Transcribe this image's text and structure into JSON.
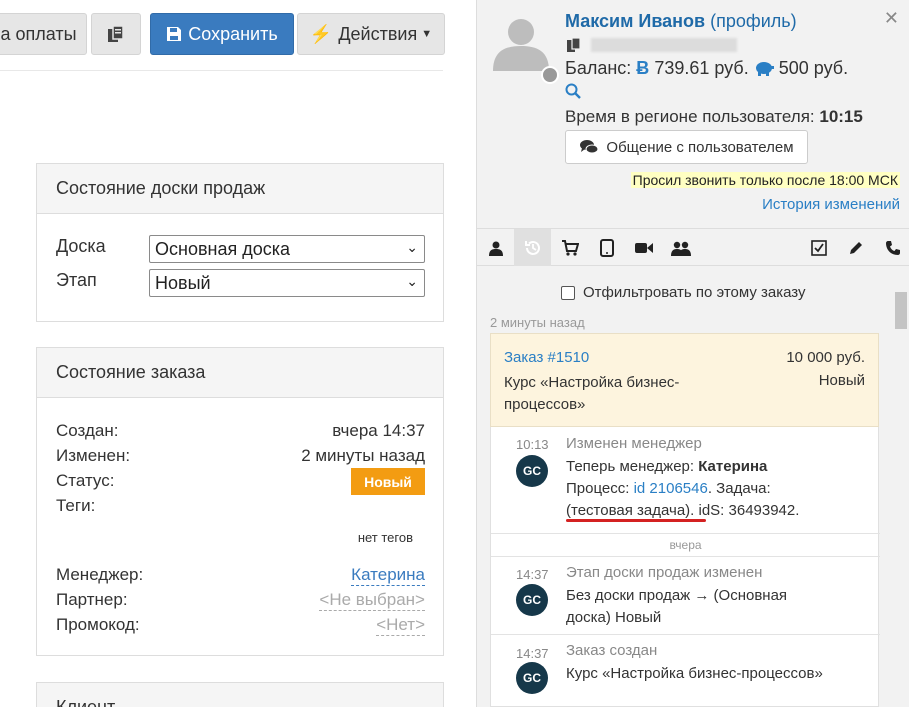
{
  "toolbar": {
    "pay_label": "а оплаты",
    "save_label": "Сохранить",
    "actions_label": "Действия"
  },
  "board_state": {
    "title": "Состояние доски продаж",
    "board_label": "Доска",
    "board_value": "Основная доска",
    "stage_label": "Этап",
    "stage_value": "Новый"
  },
  "order_state": {
    "title": "Состояние заказа",
    "created_label": "Создан:",
    "created_value": "вчера 14:37",
    "changed_label": "Изменен:",
    "changed_value": "2 минуты назад",
    "status_label": "Статус:",
    "status_value": "Новый",
    "status_color": "#f39c12",
    "tags_label": "Теги:",
    "tags_value": "нет тегов",
    "manager_label": "Менеджер:",
    "manager_value": "Катерина",
    "partner_label": "Партнер:",
    "partner_value": "<Не выбран>",
    "promo_label": "Промокод:",
    "promo_value": "<Нет>"
  },
  "client_section": {
    "title": "Клиент"
  },
  "user": {
    "name": "Максим Иванов",
    "profile_link": "(профиль)",
    "balance_label": "Баланс:",
    "balance_value": "739.61 руб.",
    "bonus_value": "500 руб.",
    "region_time_label": "Время в регионе пользователя:",
    "region_time_value": "10:15",
    "chat_button": "Общение с пользователем",
    "note": "Просил звонить только после 18:00 МСК",
    "history_link": "История изменений"
  },
  "tabs": [
    {
      "icon": "user-icon"
    },
    {
      "icon": "history-icon",
      "active": true
    },
    {
      "icon": "cart-icon"
    },
    {
      "icon": "tablet-icon"
    },
    {
      "icon": "video-icon"
    },
    {
      "icon": "group-icon"
    },
    {
      "icon": "checkbox-icon"
    },
    {
      "icon": "pencil-icon"
    },
    {
      "icon": "phone-icon"
    }
  ],
  "feed": {
    "filter_label": "Отфильтровать по этому заказу",
    "filter_checked": false,
    "timestamp": "2 минуты назад",
    "order": {
      "link": "Заказ #1510",
      "sum": "10 000 руб.",
      "name": "Курс «Настройка бизнес-процессов»",
      "status": "Новый"
    },
    "events": [
      {
        "time": "10:13",
        "title": "Изменен менеджер",
        "line1_prefix": "Теперь менеджер: ",
        "line1_bold": "Катерина",
        "proc_label": "Процесс: ",
        "proc_link": "id 2106546",
        "task_label": ". Задача:",
        "task_name": "(тестовая задача)",
        "ids_label": ". idS: 36493942."
      },
      {
        "time": "14:37",
        "title": "Этап доски продаж изменен",
        "body": "Без доски продаж → (Основная доска) Новый"
      },
      {
        "time": "14:37",
        "title": "Заказ создан",
        "body": "Курс «Настройка бизнес-процессов»"
      }
    ],
    "day_separator": "вчера",
    "avatar_text": "GC"
  }
}
